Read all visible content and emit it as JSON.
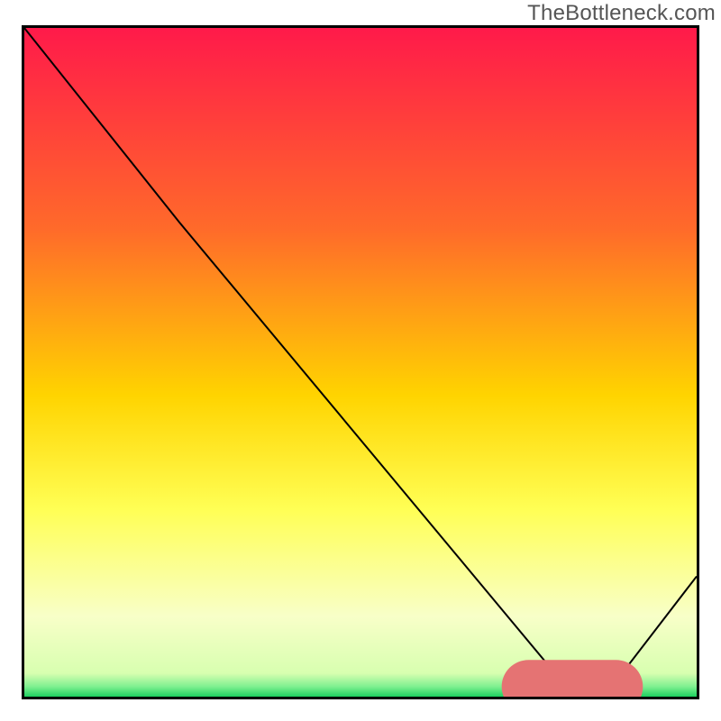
{
  "watermark": "TheBottleneck.com",
  "colors": {
    "top": "#ff1a4a",
    "mid_upper": "#ff7a2a",
    "mid": "#ffd400",
    "mid_lower": "#ffff66",
    "lower": "#f5ffb8",
    "bottom": "#2ecc71",
    "line": "#000000",
    "marker": "#e57373",
    "border": "#000000",
    "watermark": "#555555"
  },
  "chart_data": {
    "type": "line",
    "title": "",
    "xlabel": "",
    "ylabel": "",
    "xlim": [
      0,
      100
    ],
    "ylim": [
      0,
      100
    ],
    "x": [
      0,
      23,
      81,
      87,
      100
    ],
    "values": [
      100,
      71,
      1,
      1,
      18
    ],
    "marker_segment": {
      "x0": 75,
      "x1": 88,
      "y": 1.5
    },
    "gradient_stops": [
      {
        "offset": 0.0,
        "color": "#ff1a4a"
      },
      {
        "offset": 0.3,
        "color": "#ff6a2a"
      },
      {
        "offset": 0.55,
        "color": "#ffd400"
      },
      {
        "offset": 0.72,
        "color": "#ffff55"
      },
      {
        "offset": 0.88,
        "color": "#f8ffc8"
      },
      {
        "offset": 0.965,
        "color": "#d8ffb0"
      },
      {
        "offset": 0.985,
        "color": "#7ff090"
      },
      {
        "offset": 1.0,
        "color": "#1dd060"
      }
    ]
  }
}
